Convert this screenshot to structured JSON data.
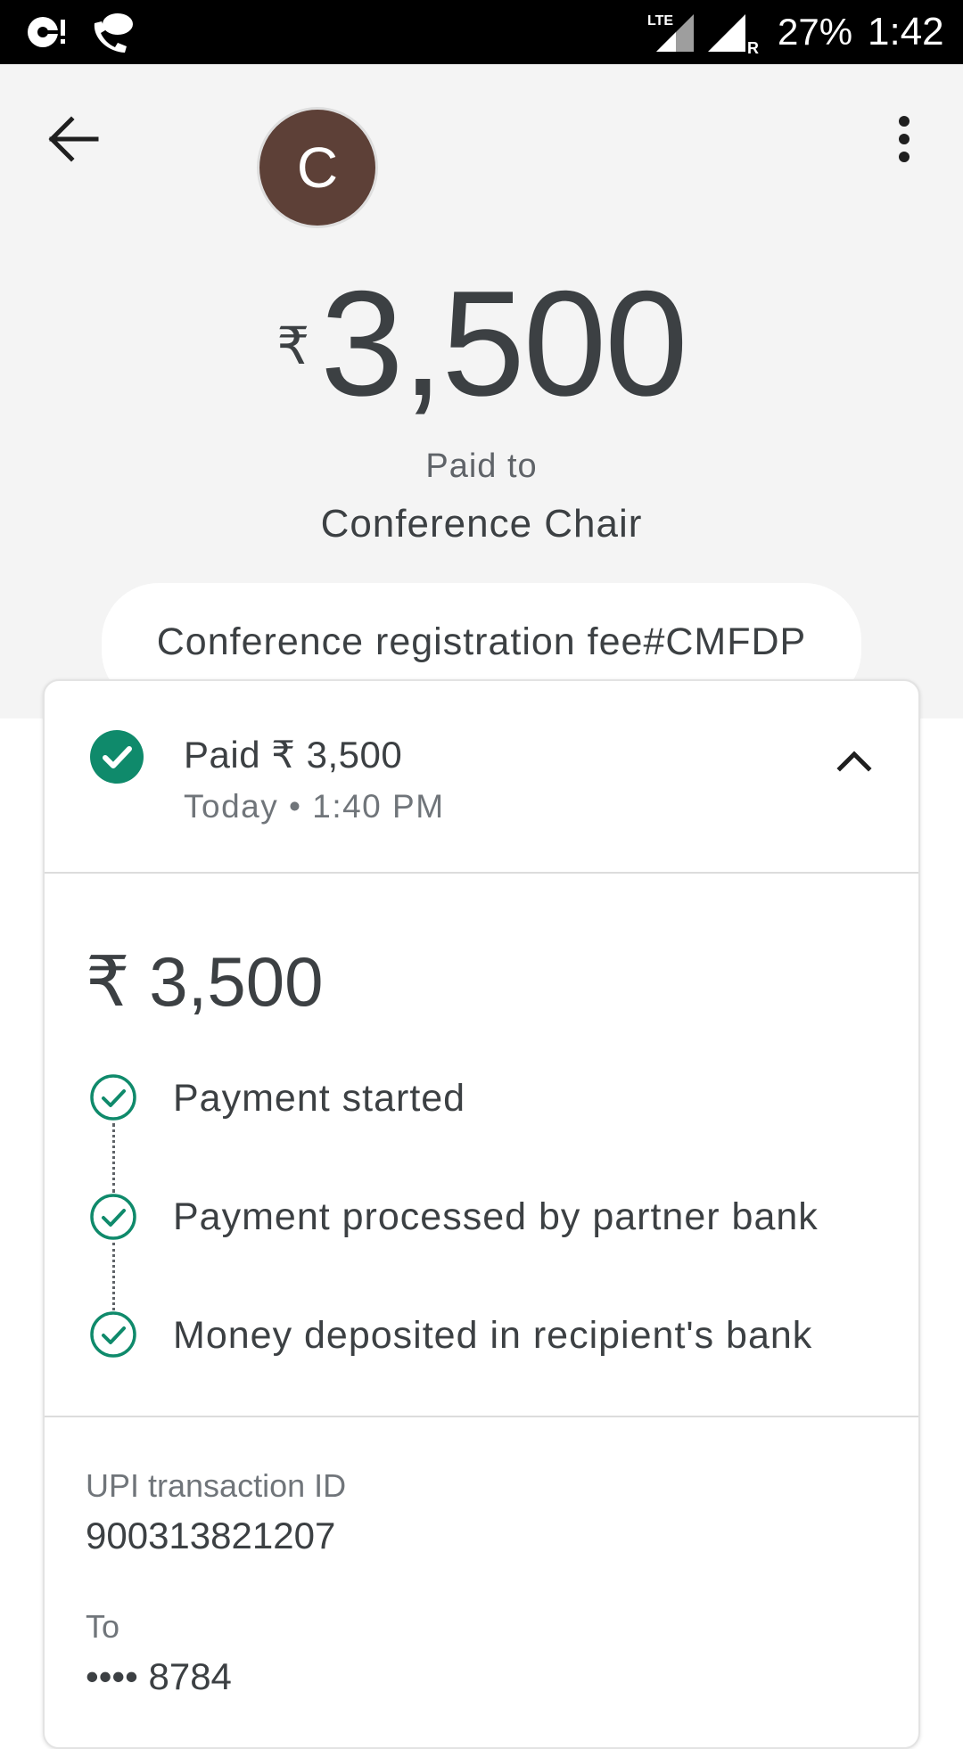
{
  "status_bar": {
    "network_label": "LTE",
    "roaming_label": "R",
    "battery": "27%",
    "time": "1:42"
  },
  "header": {
    "back_icon": "arrow-back-icon",
    "more_icon": "more-vert-icon",
    "avatar_letter": "C",
    "avatar_color": "#5d4037",
    "currency_symbol": "₹",
    "amount": "3,500",
    "paid_to_label": "Paid to",
    "payee_name": "Conference Chair",
    "note": "Conference registration fee#CMFDP"
  },
  "card": {
    "status_title": "Paid ₹ 3,500",
    "status_time": "Today • 1:40 PM",
    "status_icon": "check-circle-icon",
    "collapse_icon": "chevron-up-icon",
    "detail_amount": "₹ 3,500",
    "steps": [
      {
        "label": "Payment started",
        "icon": "check-circle-outline-icon"
      },
      {
        "label": "Payment processed by partner bank",
        "icon": "check-circle-outline-icon"
      },
      {
        "label": "Money deposited in recipient's bank",
        "icon": "check-circle-outline-icon"
      }
    ],
    "transaction_id_label": "UPI transaction ID",
    "transaction_id": "900313821207",
    "to_label": "To",
    "to_value": "•••• 8784"
  },
  "colors": {
    "success_green": "#0f8a6b",
    "header_background": "#f4f4f4",
    "status_bar_background": "#000000"
  }
}
